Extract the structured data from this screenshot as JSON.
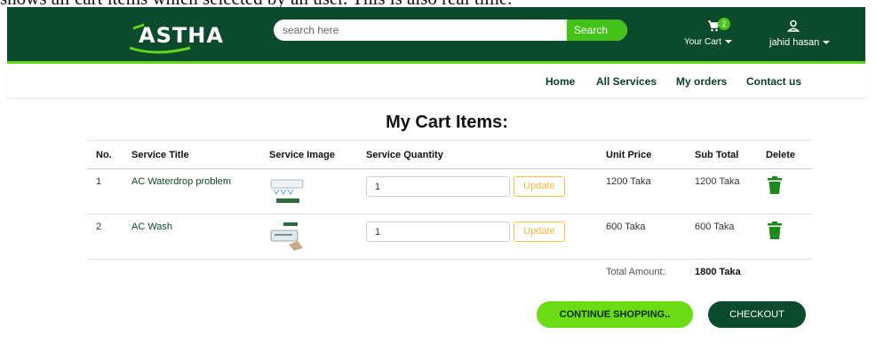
{
  "caption": "shows all cart items which selected by an user. This is also real time.",
  "brand": {
    "logo_text": "ASTHA",
    "primary_color": "#0b4a2a",
    "accent_color": "#64d51d"
  },
  "search": {
    "placeholder": "search here",
    "button_label": "Search"
  },
  "cart": {
    "icon": "cart-icon",
    "badge_count": "2",
    "label": "Your Cart"
  },
  "user": {
    "icon": "user-icon",
    "name": "jahid hasan"
  },
  "nav": {
    "items": [
      "Home",
      "All Services",
      "My orders",
      "Contact us"
    ]
  },
  "page_title": "My Cart Items:",
  "table": {
    "headers": [
      "No.",
      "Service Title",
      "Service Image",
      "Service Quantity",
      "Unit Price",
      "Sub Total",
      "Delete"
    ],
    "rows": [
      {
        "no": "1",
        "title": "AC Waterdrop problem",
        "image": "ac-waterdrop-thumbnail",
        "quantity": "1",
        "update_label": "Update",
        "unit_price": "1200 Taka",
        "sub_total": "1200 Taka",
        "delete_icon": "trash-icon"
      },
      {
        "no": "2",
        "title": "AC Wash",
        "image": "ac-wash-thumbnail",
        "quantity": "1",
        "update_label": "Update",
        "unit_price": "600 Taka",
        "sub_total": "600 Taka",
        "delete_icon": "trash-icon"
      }
    ],
    "total_label": "Total Amount:",
    "total_value": "1800 Taka"
  },
  "buttons": {
    "continue_label": "CONTINUE SHOPPING..",
    "checkout_label": "CHECKOUT"
  }
}
